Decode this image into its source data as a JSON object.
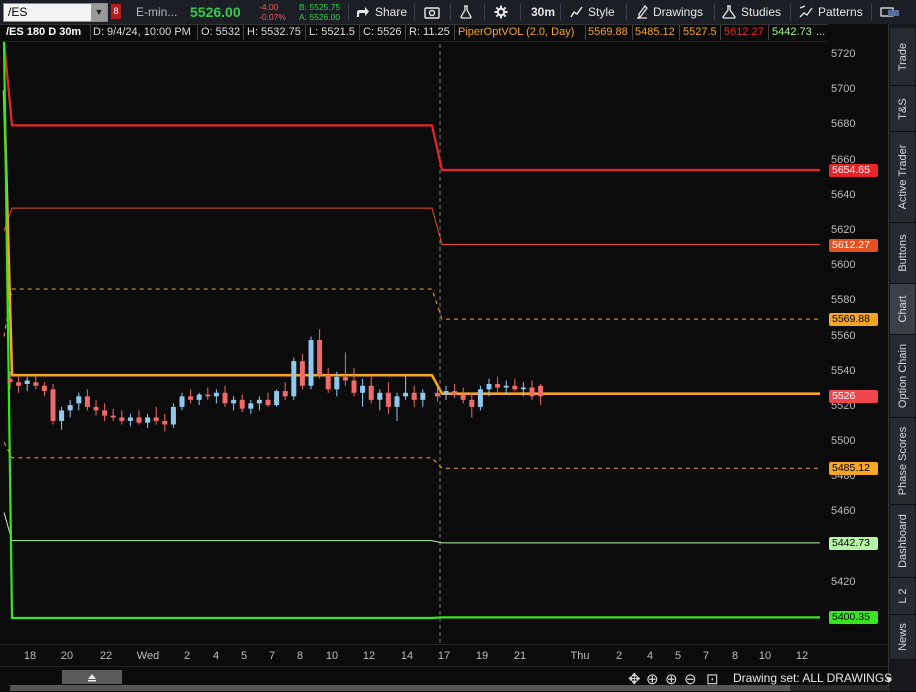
{
  "toolbar": {
    "symbol": "/ES",
    "flag": "8",
    "instrument_desc": "E-min...",
    "last_price": "5526.00",
    "net_change": "-4.00",
    "pct_change": "-0.07%",
    "bid": "B: 5525.75",
    "ask": "A: 5526.00",
    "share": "Share",
    "timeframe": "30m",
    "style": "Style",
    "drawings": "Drawings",
    "studies": "Studies",
    "patterns": "Patterns"
  },
  "infobar": {
    "title": "/ES 180 D 30m",
    "date": "D: 9/4/24, 10:00 PM",
    "open": "O: 5532",
    "high": "H: 5532.75",
    "low": "L: 5521.5",
    "close": "C: 5526",
    "range": "R: 11.25",
    "study": "PiperOptVOL (2.0, Day)",
    "v1": "5569.88",
    "v2": "5485.12",
    "v3": "5527.5",
    "v4": "5612.27",
    "v5": "5442.73",
    "overflow": "..."
  },
  "yaxis": {
    "ticks": [
      "5720",
      "5700",
      "5680",
      "5660",
      "5640",
      "5620",
      "5600",
      "5580",
      "5560",
      "5540",
      "5520",
      "5500",
      "5480",
      "5460",
      "5440",
      "5420",
      "5400"
    ],
    "labels": [
      {
        "text": "5654.65",
        "bg": "#e8262a",
        "fg": "#ffffff",
        "y": 5654.65
      },
      {
        "text": "5612.27",
        "bg": "#e8501f",
        "fg": "#ffffff",
        "y": 5612.27
      },
      {
        "text": "5569.88",
        "bg": "#f5a623",
        "fg": "#000000",
        "y": 5569.88
      },
      {
        "text": "5526",
        "bg": "#f0464e",
        "fg": "#ffffff",
        "y": 5526
      },
      {
        "text": "5485.12",
        "bg": "#f5a623",
        "fg": "#000000",
        "y": 5485.12
      },
      {
        "text": "5442.73",
        "bg": "#b7f5a6",
        "fg": "#000000",
        "y": 5442.73
      },
      {
        "text": "5400.35",
        "bg": "#39e51f",
        "fg": "#000000",
        "y": 5400.35
      }
    ]
  },
  "xaxis": {
    "ticks": [
      "18",
      "20",
      "22",
      "Wed",
      "2",
      "4",
      "5",
      "7",
      "8",
      "10",
      "12",
      "14",
      "17",
      "19",
      "21",
      "Thu",
      "2",
      "4",
      "5",
      "7",
      "8",
      "10",
      "12"
    ]
  },
  "sidetabs": [
    "Trade",
    "T&S",
    "Active Trader",
    "Buttons",
    "Chart",
    "Option Chain",
    "Phase Scores",
    "Dashboard",
    "L 2",
    "News"
  ],
  "bottom": {
    "drawing_set": "Drawing set: ALL DRAWINGS"
  },
  "chart_data": {
    "type": "candlestick",
    "ylim": [
      5388,
      5728
    ],
    "candles": [
      [
        5536,
        5540,
        5530,
        5534
      ],
      [
        5534,
        5538,
        5528,
        5532
      ],
      [
        5533,
        5537,
        5529,
        5535
      ],
      [
        5534,
        5538,
        5530,
        5532
      ],
      [
        5532,
        5534,
        5526,
        5529
      ],
      [
        5530,
        5533,
        5510,
        5512
      ],
      [
        5512,
        5520,
        5507,
        5518
      ],
      [
        5518,
        5524,
        5514,
        5521
      ],
      [
        5522,
        5528,
        5518,
        5526
      ],
      [
        5526,
        5530,
        5518,
        5520
      ],
      [
        5520,
        5524,
        5515,
        5518
      ],
      [
        5518,
        5522,
        5512,
        5515
      ],
      [
        5515,
        5519,
        5512,
        5514
      ],
      [
        5514,
        5518,
        5510,
        5512
      ],
      [
        5512,
        5516,
        5509,
        5514
      ],
      [
        5514,
        5518,
        5510,
        5511
      ],
      [
        5511,
        5516,
        5508,
        5514
      ],
      [
        5514,
        5520,
        5510,
        5512
      ],
      [
        5512,
        5516,
        5506,
        5510
      ],
      [
        5510,
        5522,
        5508,
        5520
      ],
      [
        5520,
        5528,
        5518,
        5526
      ],
      [
        5526,
        5530,
        5522,
        5524
      ],
      [
        5524,
        5528,
        5521,
        5527
      ],
      [
        5527,
        5531,
        5524,
        5526
      ],
      [
        5526,
        5530,
        5522,
        5528
      ],
      [
        5528,
        5532,
        5520,
        5522
      ],
      [
        5522,
        5526,
        5518,
        5524
      ],
      [
        5524,
        5527,
        5517,
        5519
      ],
      [
        5519,
        5524,
        5516,
        5522
      ],
      [
        5522,
        5526,
        5518,
        5524
      ],
      [
        5524,
        5528,
        5520,
        5521
      ],
      [
        5521,
        5530,
        5520,
        5529
      ],
      [
        5529,
        5534,
        5524,
        5526
      ],
      [
        5526,
        5548,
        5524,
        5546
      ],
      [
        5546,
        5550,
        5530,
        5532
      ],
      [
        5532,
        5560,
        5530,
        5558
      ],
      [
        5558,
        5564,
        5536,
        5538
      ],
      [
        5538,
        5542,
        5528,
        5530
      ],
      [
        5530,
        5540,
        5526,
        5537
      ],
      [
        5537,
        5551,
        5532,
        5535
      ],
      [
        5535,
        5542,
        5526,
        5528
      ],
      [
        5528,
        5536,
        5520,
        5532
      ],
      [
        5532,
        5538,
        5522,
        5524
      ],
      [
        5524,
        5530,
        5518,
        5528
      ],
      [
        5528,
        5534,
        5516,
        5520
      ],
      [
        5520,
        5528,
        5512,
        5526
      ],
      [
        5526,
        5538,
        5524,
        5528
      ],
      [
        5528,
        5532,
        5520,
        5524
      ],
      [
        5524,
        5530,
        5520,
        5528
      ],
      [
        5528,
        5532,
        5523,
        5526
      ],
      [
        5527,
        5532,
        5524,
        5529
      ],
      [
        5529,
        5533,
        5525,
        5527
      ],
      [
        5527,
        5531,
        5522,
        5524
      ],
      [
        5524,
        5528,
        5514,
        5520
      ],
      [
        5520,
        5532,
        5518,
        5530
      ],
      [
        5530,
        5536,
        5526,
        5533
      ],
      [
        5533,
        5537,
        5528,
        5531
      ],
      [
        5531,
        5535,
        5527,
        5532
      ],
      [
        5532,
        5536,
        5529,
        5530
      ],
      [
        5530,
        5534,
        5526,
        5531
      ],
      [
        5531,
        5535,
        5524,
        5526
      ],
      [
        5532,
        5533,
        5521,
        5526
      ]
    ]
  },
  "colors": {
    "up": "#8fc9f0",
    "down": "#f06a6a",
    "bg": "#0b0b0b"
  }
}
